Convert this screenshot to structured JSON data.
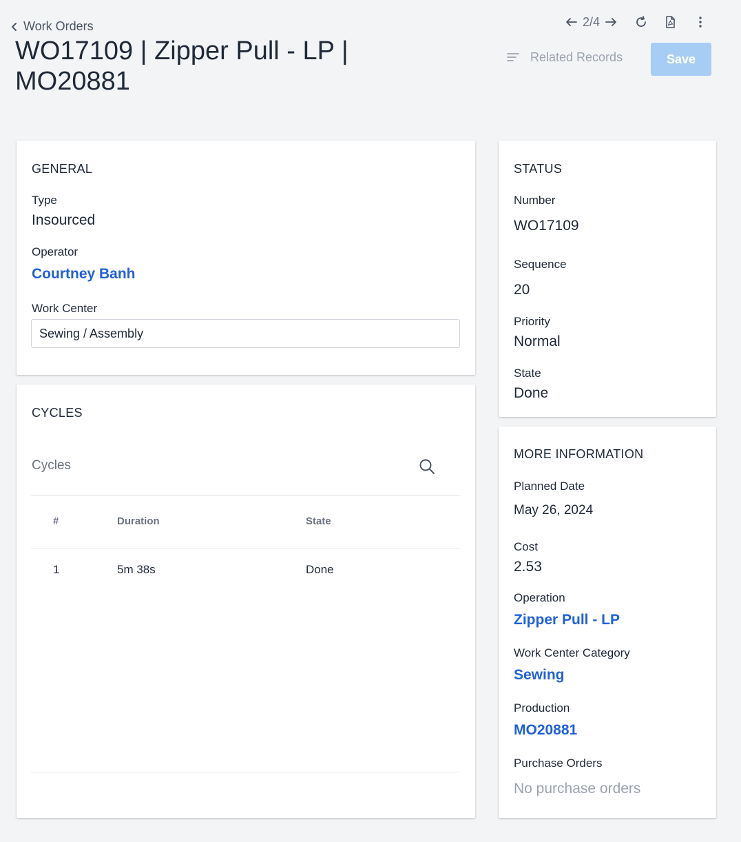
{
  "header": {
    "back_label": "Work Orders",
    "title": "WO17109 | Zipper Pull - LP | MO20881",
    "pager": "2/4",
    "related_records_label": "Related Records",
    "save_label": "Save"
  },
  "icons": {
    "back": "chevron-left-icon",
    "prev": "arrow-left-icon",
    "next": "arrow-right-icon",
    "refresh": "refresh-icon",
    "pdf": "pdf-icon",
    "more": "more-vertical-icon",
    "related": "list-icon",
    "search": "search-icon"
  },
  "colors": {
    "link": "#2160d9",
    "save_disabled": "#a8cdf4",
    "background": "#f3f4f6"
  },
  "general": {
    "title": "GENERAL",
    "type_label": "Type",
    "type_value": "Insourced",
    "operator_label": "Operator",
    "operator_value": "Courtney Banh",
    "work_center_label": "Work Center",
    "work_center_value": "Sewing / Assembly"
  },
  "cycles": {
    "title": "CYCLES",
    "search_placeholder": "Cycles",
    "columns": [
      "#",
      "Duration",
      "State"
    ],
    "rows": [
      {
        "num": "1",
        "duration": "5m 38s",
        "state": "Done"
      }
    ]
  },
  "status": {
    "title": "STATUS",
    "number_label": "Number",
    "number_value": "WO17109",
    "sequence_label": "Sequence",
    "sequence_value": "20",
    "priority_label": "Priority",
    "priority_value": "Normal",
    "state_label": "State",
    "state_value": "Done"
  },
  "more_info": {
    "title": "MORE INFORMATION",
    "planned_date_label": "Planned Date",
    "planned_date_value": "May 26, 2024",
    "cost_label": "Cost",
    "cost_value": "2.53",
    "operation_label": "Operation",
    "operation_value": "Zipper Pull - LP",
    "wc_category_label": "Work Center Category",
    "wc_category_value": "Sewing",
    "production_label": "Production",
    "production_value": "MO20881",
    "purchase_orders_label": "Purchase Orders",
    "purchase_orders_value": "No purchase orders"
  }
}
